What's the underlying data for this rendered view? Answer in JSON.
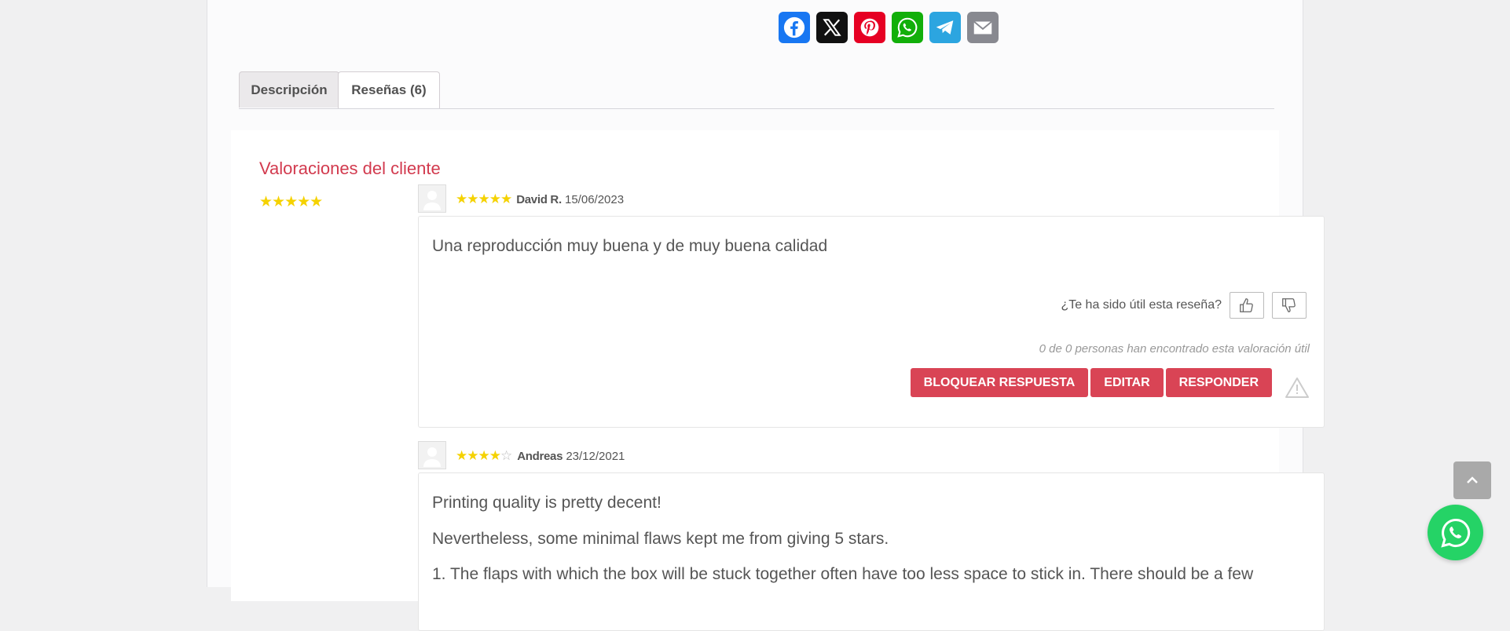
{
  "share": {
    "buttons": [
      {
        "name": "facebook",
        "icon": "facebook-icon",
        "color": "#1877f2"
      },
      {
        "name": "x",
        "icon": "x-icon",
        "color": "#111111"
      },
      {
        "name": "pinterest",
        "icon": "pinterest-icon",
        "color": "#e60023"
      },
      {
        "name": "whatsapp",
        "icon": "whatsapp-icon",
        "color": "#12af0a"
      },
      {
        "name": "telegram",
        "icon": "telegram-icon",
        "color": "#2ca5e0"
      },
      {
        "name": "email",
        "icon": "email-icon",
        "color": "#888990"
      }
    ]
  },
  "tabs": {
    "description": "Descripción",
    "reviews": "Reseñas (6)"
  },
  "reviews_section": {
    "title": "Valoraciones del cliente",
    "overall_rating": 5,
    "stars_overall": "★★★★★"
  },
  "reviews": [
    {
      "rating": 5,
      "stars": "★★★★★",
      "author": "David R.",
      "date": "15/06/2023",
      "text": "Una reproducción muy buena y de muy buena calidad",
      "helpful_question": "¿Te ha sido útil esta reseña?",
      "helpful_count": "0 de 0 personas han encontrado esta valoración útil",
      "actions": [
        "BLOQUEAR RESPUESTA",
        "EDITAR",
        "RESPONDER"
      ]
    },
    {
      "rating": 4,
      "stars": "★★★★",
      "stars_empty": "☆",
      "author": "Andreas",
      "date": "23/12/2021",
      "paragraphs": [
        "Printing quality is pretty decent!",
        "Nevertheless, some minimal flaws kept me from giving 5 stars.",
        "1. The flaps with which the box will be stuck together often have too less space to stick in. There should be a few"
      ]
    }
  ],
  "colors": {
    "accent": "#d94455",
    "title": "#d23a4e",
    "star": "#f5d200",
    "whatsapp": "#25d366"
  }
}
